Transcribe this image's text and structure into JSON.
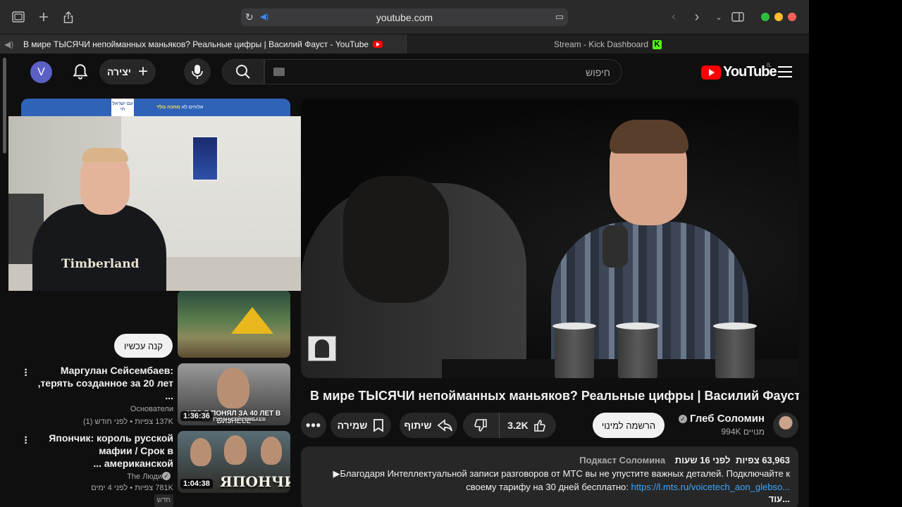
{
  "browser": {
    "url": "youtube.com",
    "tabs": [
      {
        "title": "В мире ТЫСЯЧИ непойманных маньяков? Реальные цифры | Василий Фауст - YouTube",
        "active": true
      },
      {
        "title": "Stream - Kick Dashboard",
        "active": false
      }
    ],
    "traffic_colors": [
      "#2dc040",
      "#febc2e",
      "#ff5f57"
    ]
  },
  "masthead": {
    "avatar_letter": "V",
    "create_label": "יצירה",
    "search_placeholder": "חיפוש",
    "logo_text": "YouTube",
    "country_code": "IL"
  },
  "ad": {
    "logo_text": "עם ישראל חי",
    "banner_text_prefix": "אלוהים לא",
    "banner_text_highlight": "מחכה נולד",
    "buy_label": "קנה עכשיו"
  },
  "webcam": {
    "shirt_text": "Timberland"
  },
  "recommendations": [
    {
      "title": "Маргулан Сейсембаев: терять созданное за 20 лет, ...",
      "channel": "Основатели",
      "meta": "137K צפיות • לפני חודש (1)",
      "duration": "1:36:36",
      "thumb_caption": "ЧТО Я ПОНЯЛ ЗА 40 ЛЕТ В БИЗНЕСЕ",
      "thumb_sub": "МАРГУЛАН СЕЙСЕМБАЕВ"
    },
    {
      "title": "Япончик: король русской мафии / Срок в американской ...",
      "channel": "The Люди",
      "meta": "781K צפיות • לפני 4 ימים",
      "badge": "חדש",
      "duration": "1:04:38",
      "thumb_caption": "ЯПОНЧИК"
    }
  ],
  "video": {
    "title": "В мире ТЫСЯЧИ непойманных маньяков? Реальные цифры | Василий Фауст",
    "channel_name": "Глеб Соломин",
    "subscribers": "994K מנויים",
    "subscribe_label": "הרשמה למינוי",
    "likes": "3.2K",
    "share_label": "שיתוף",
    "save_label": "שמירה",
    "views": "63,963 צפיות",
    "time_ago": "לפני 16 שעות",
    "podcast_channel": "Подкаст Соломина",
    "description_line1": "▶Благодаря Интеллектуальной записи разговоров от МТС вы не упустите важных деталей. Подключайте к",
    "description_line2": "своему тарифу на 30 дней бесплатно:",
    "description_link": "https://l.mts.ru/voicetech_aon_glebso...",
    "more_label": "...עוד"
  },
  "colors": {
    "youtube_red": "#ff0000",
    "link_blue": "#3ea6ff",
    "kick_green": "#53fc18",
    "avatar_purple": "#5c5fc4"
  },
  "icons": [
    "sidebar-toggle-icon",
    "new-tab-icon",
    "share-icon",
    "reload-icon",
    "audio-icon",
    "reader-icon",
    "back-icon",
    "forward-icon",
    "chevron-down-icon",
    "sidebar-icon",
    "bell-icon",
    "plus-icon",
    "mic-icon",
    "search-icon",
    "keyboard-icon",
    "menu-icon",
    "save-icon",
    "share-arrow-icon",
    "dislike-icon",
    "like-icon",
    "more-icon",
    "verified-icon",
    "kebab-icon"
  ]
}
